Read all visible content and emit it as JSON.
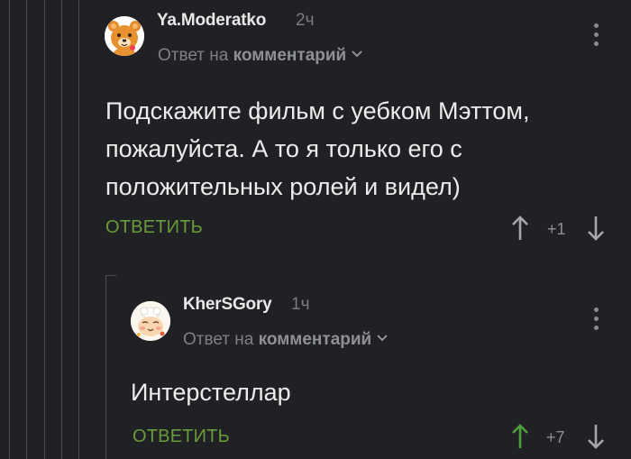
{
  "comments": [
    {
      "author": "Ya.Moderatko",
      "time": "2ч",
      "reply_prefix": "Ответ на",
      "reply_target": "комментарий",
      "text_lines": [
        "Подскажите фильм с уебком Мэттом,",
        "пожалуйста. А то я только его с",
        "положительных ролей и видел)"
      ],
      "reply_label": "ОТВЕТИТЬ",
      "rating": "+1",
      "upvoted": false
    },
    {
      "author": "KherSGory",
      "time": "1ч",
      "reply_prefix": "Ответ на",
      "reply_target": "комментарий",
      "text_lines": [
        "Интерстеллар"
      ],
      "reply_label": "ОТВЕТИТЬ",
      "rating": "+7",
      "upvoted": true
    }
  ],
  "colors": {
    "background": "#202124",
    "reply_green": "#6a9b3a",
    "upvote_active": "#4f9e3a",
    "muted": "#7e8084"
  },
  "icons": {
    "avatar_1": "bear-avatar-icon",
    "avatar_2": "chef-face-avatar-icon"
  }
}
